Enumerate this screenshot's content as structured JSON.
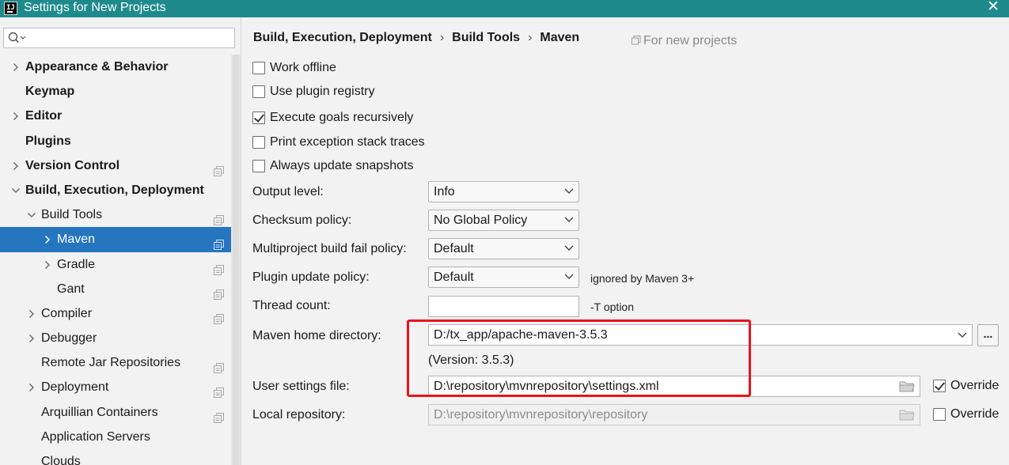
{
  "window": {
    "title": "Settings for New Projects",
    "app_icon_text": "IJ",
    "close_glyph": "✕"
  },
  "sidebar": {
    "search_placeholder": "",
    "items": [
      {
        "label": "Appearance & Behavior",
        "bold": true,
        "chevron": "right",
        "level": 0,
        "project_icon": false
      },
      {
        "label": "Keymap",
        "bold": true,
        "chevron": "none",
        "level": 0,
        "project_icon": false
      },
      {
        "label": "Editor",
        "bold": true,
        "chevron": "right",
        "level": 0,
        "project_icon": false
      },
      {
        "label": "Plugins",
        "bold": true,
        "chevron": "none",
        "level": 0,
        "project_icon": false
      },
      {
        "label": "Version Control",
        "bold": true,
        "chevron": "right",
        "level": 0,
        "project_icon": true
      },
      {
        "label": "Build, Execution, Deployment",
        "bold": true,
        "chevron": "down",
        "level": 0,
        "project_icon": false
      },
      {
        "label": "Build Tools",
        "bold": false,
        "chevron": "down",
        "level": 1,
        "project_icon": true
      },
      {
        "label": "Maven",
        "bold": false,
        "chevron": "right",
        "level": 2,
        "project_icon": true,
        "selected": true
      },
      {
        "label": "Gradle",
        "bold": false,
        "chevron": "right",
        "level": 2,
        "project_icon": true
      },
      {
        "label": "Gant",
        "bold": false,
        "chevron": "none",
        "level": 2,
        "project_icon": true
      },
      {
        "label": "Compiler",
        "bold": false,
        "chevron": "right",
        "level": 1,
        "project_icon": true
      },
      {
        "label": "Debugger",
        "bold": false,
        "chevron": "right",
        "level": 1,
        "project_icon": false
      },
      {
        "label": "Remote Jar Repositories",
        "bold": false,
        "chevron": "none",
        "level": 1,
        "project_icon": true
      },
      {
        "label": "Deployment",
        "bold": false,
        "chevron": "right",
        "level": 1,
        "project_icon": true
      },
      {
        "label": "Arquillian Containers",
        "bold": false,
        "chevron": "none",
        "level": 1,
        "project_icon": true
      },
      {
        "label": "Application Servers",
        "bold": false,
        "chevron": "none",
        "level": 1,
        "project_icon": false
      },
      {
        "label": "Clouds",
        "bold": false,
        "chevron": "none",
        "level": 1,
        "project_icon": false
      }
    ]
  },
  "breadcrumb": {
    "parts": [
      "Build, Execution, Deployment",
      "Build Tools",
      "Maven"
    ],
    "separator": "›",
    "scope_note": "For new projects"
  },
  "options": [
    {
      "label": "Work offline",
      "checked": false
    },
    {
      "label": "Use plugin registry",
      "checked": false
    },
    {
      "label": "Execute goals recursively",
      "checked": true
    },
    {
      "label": "Print exception stack traces",
      "checked": false
    },
    {
      "label": "Always update snapshots",
      "checked": false
    }
  ],
  "fields": {
    "output_level": {
      "label": "Output level:",
      "value": "Info"
    },
    "checksum_policy": {
      "label": "Checksum policy:",
      "value": "No Global Policy"
    },
    "multiproject_fail_policy": {
      "label": "Multiproject build fail policy:",
      "value": "Default"
    },
    "plugin_update_policy": {
      "label": "Plugin update policy:",
      "value": "Default",
      "hint": "ignored by Maven 3+"
    },
    "thread_count": {
      "label": "Thread count:",
      "value": "",
      "hint": "-T option"
    },
    "maven_home": {
      "label": "Maven home directory:",
      "value": "D:/tx_app/apache-maven-3.5.3",
      "version": "(Version: 3.5.3)",
      "browse_label": "..."
    },
    "user_settings": {
      "label": "User settings file:",
      "value": "D:\\repository\\mvnrepository\\settings.xml",
      "override_label": "Override",
      "override_checked": true
    },
    "local_repository": {
      "label": "Local repository:",
      "value": "D:\\repository\\mvnrepository\\repository",
      "override_label": "Override",
      "override_checked": false
    }
  },
  "colors": {
    "titlebar": "#1f8a8c",
    "selection": "#2675bf",
    "annotation": "#e8141a"
  }
}
